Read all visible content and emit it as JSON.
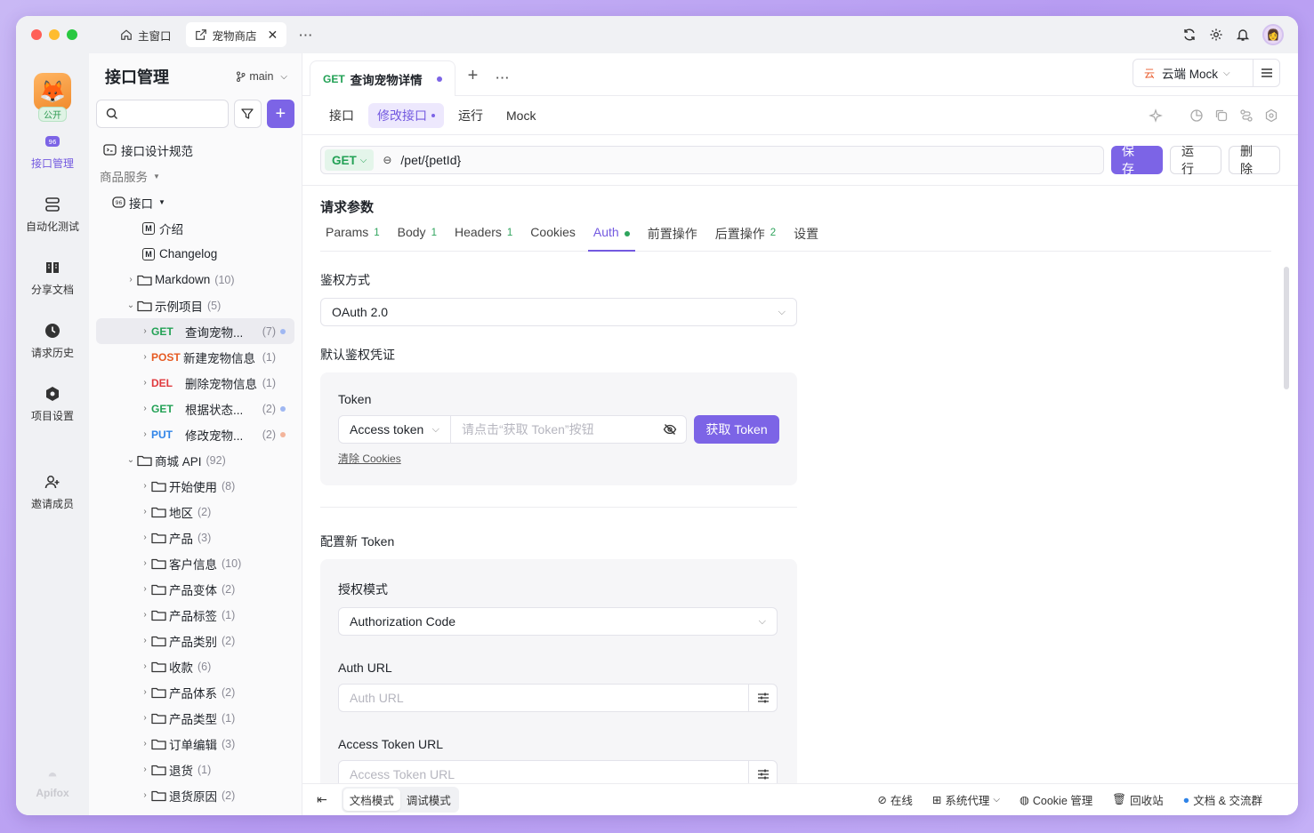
{
  "window_tabs": [
    {
      "label": "主窗口",
      "active": false
    },
    {
      "label": "宠物商店",
      "active": true
    }
  ],
  "rail": {
    "public_badge": "公开",
    "items": [
      {
        "label": "接口管理",
        "icon": "api-icon",
        "active": true
      },
      {
        "label": "自动化测试",
        "icon": "automation-icon",
        "active": false
      },
      {
        "label": "分享文档",
        "icon": "book-icon",
        "active": false
      },
      {
        "label": "请求历史",
        "icon": "history-icon",
        "active": false
      },
      {
        "label": "项目设置",
        "icon": "settings-icon",
        "active": false
      },
      {
        "label": "邀请成员",
        "icon": "invite-user-icon",
        "active": false
      }
    ],
    "brand": "Apifox"
  },
  "sidebar": {
    "title": "接口管理",
    "branch": "main",
    "design_spec": "接口设计规范",
    "section": "商品服务",
    "root": "接口",
    "intro": "介绍",
    "changelog": "Changelog",
    "markdown": {
      "label": "Markdown",
      "count": "(10)"
    },
    "examples": {
      "label": "示例项目",
      "count": "(5)"
    },
    "endpoints": [
      {
        "method": "GET",
        "name": "查询宠物...",
        "count": "(7)",
        "dot": "#9fb7f2",
        "selected": true
      },
      {
        "method": "POST",
        "name": "新建宠物信息",
        "count": "(1)",
        "dot": "",
        "selected": false
      },
      {
        "method": "DEL",
        "name": "删除宠物信息",
        "count": "(1)",
        "dot": "",
        "selected": false
      },
      {
        "method": "GET",
        "name": "根据状态...",
        "count": "(2)",
        "dot": "#9fb7f2",
        "selected": false
      },
      {
        "method": "PUT",
        "name": "修改宠物...",
        "count": "(2)",
        "dot": "#f3b49b",
        "selected": false
      }
    ],
    "mall": {
      "label": "商城 API",
      "count": "(92)"
    },
    "mall_folders": [
      {
        "label": "开始使用",
        "count": "(8)"
      },
      {
        "label": "地区",
        "count": "(2)"
      },
      {
        "label": "产品",
        "count": "(3)"
      },
      {
        "label": "客户信息",
        "count": "(10)"
      },
      {
        "label": "产品变体",
        "count": "(2)"
      },
      {
        "label": "产品标签",
        "count": "(1)"
      },
      {
        "label": "产品类别",
        "count": "(2)"
      },
      {
        "label": "收款",
        "count": "(6)"
      },
      {
        "label": "产品体系",
        "count": "(2)"
      },
      {
        "label": "产品类型",
        "count": "(1)"
      },
      {
        "label": "订单编辑",
        "count": "(3)"
      },
      {
        "label": "退货",
        "count": "(1)"
      },
      {
        "label": "退货原因",
        "count": "(2)"
      }
    ]
  },
  "doc_tab": {
    "method": "GET",
    "title": "查询宠物详情"
  },
  "env": {
    "badge": "云",
    "label": "云端 Mock"
  },
  "subtabs": [
    "接口",
    "修改接口",
    "运行",
    "Mock"
  ],
  "url": {
    "method": "GET",
    "path": "/pet/{petId}"
  },
  "actions": {
    "save": "保 存",
    "run": "运 行",
    "delete": "删 除"
  },
  "params": {
    "title": "请求参数",
    "tabs": [
      {
        "label": "Params",
        "n": "1"
      },
      {
        "label": "Body",
        "n": "1"
      },
      {
        "label": "Headers",
        "n": "1"
      },
      {
        "label": "Cookies",
        "n": ""
      },
      {
        "label": "Auth",
        "n": ""
      },
      {
        "label": "前置操作",
        "n": ""
      },
      {
        "label": "后置操作",
        "n": "2"
      },
      {
        "label": "设置",
        "n": ""
      }
    ]
  },
  "auth": {
    "method_label": "鉴权方式",
    "method_value": "OAuth 2.0",
    "default_label": "默认鉴权凭证",
    "token_label": "Token",
    "token_type": "Access token",
    "token_placeholder": "请点击“获取 Token”按钮",
    "get_token": "获取 Token",
    "clear_cookies": "清除 Cookies",
    "new_token_label": "配置新 Token",
    "grant_label": "授权模式",
    "grant_value": "Authorization Code",
    "auth_url_label": "Auth URL",
    "auth_url_placeholder": "Auth URL",
    "access_url_label": "Access Token URL",
    "access_url_placeholder": "Access Token URL"
  },
  "footer": {
    "doc_mode": "文档模式",
    "debug_mode": "调试模式",
    "online": "在线",
    "proxy": "系统代理",
    "cookie": "Cookie 管理",
    "trash": "回收站",
    "community": "文档 & 交流群"
  }
}
